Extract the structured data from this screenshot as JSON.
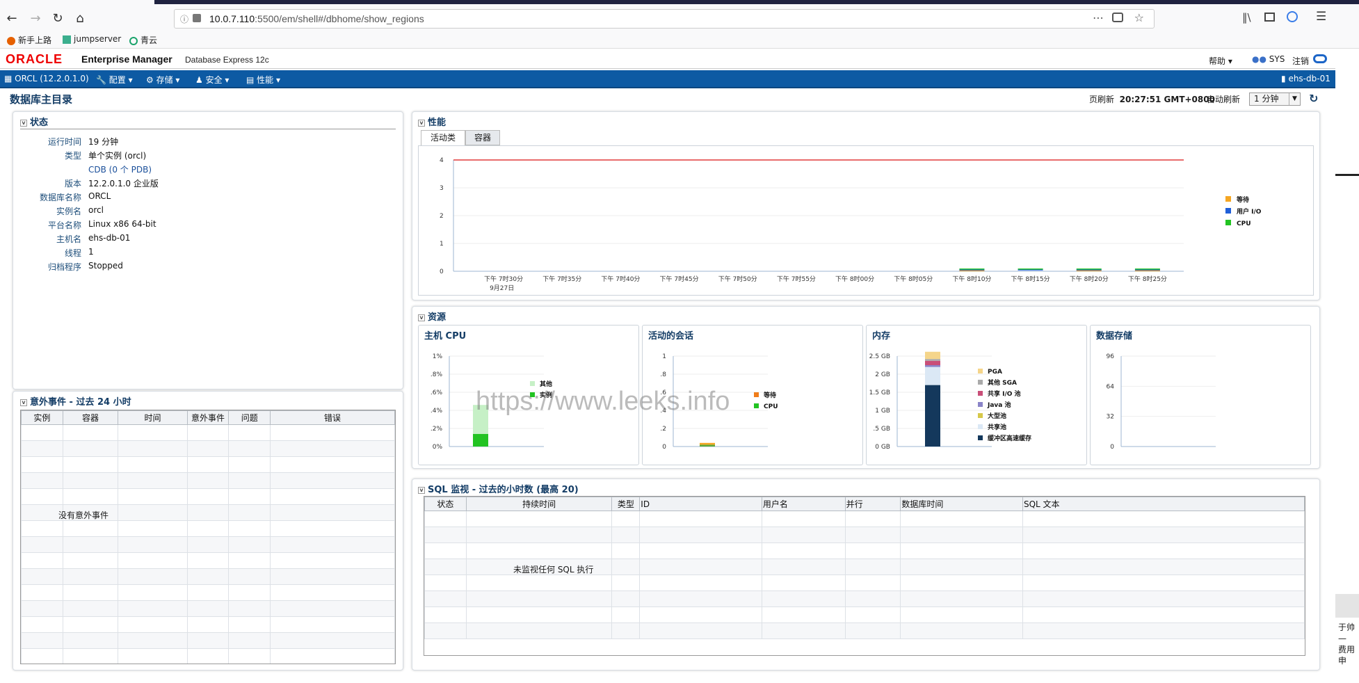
{
  "browser": {
    "url_host": "10.0.7.110",
    "url_rest": ":5500/em/shell#/dbhome/show_regions",
    "bookmarks": [
      "新手上路",
      "jumpserver",
      "青云"
    ]
  },
  "header": {
    "logo": "ORACLE",
    "product": "Enterprise Manager",
    "edition": "Database Express 12c",
    "help": "帮助",
    "user": "SYS",
    "logout": "注销"
  },
  "navbar": {
    "instance": "ORCL (12.2.0.1.0)",
    "menus": [
      "配置",
      "存储",
      "安全",
      "性能"
    ],
    "host": "ehs-db-01"
  },
  "page": {
    "title": "数据库主目录",
    "refresh_label": "页刷新",
    "refresh_time": "20:27:51 GMT+0800",
    "auto_refresh_label": "自动刷新",
    "auto_refresh_value": "1 分钟"
  },
  "status": {
    "title": "状态",
    "rows": [
      {
        "label": "运行时间",
        "value": "19 分钟"
      },
      {
        "label": "类型",
        "value": "单个实例 (orcl)"
      },
      {
        "label": "",
        "value": "CDB (0 个 PDB)"
      },
      {
        "label": "版本",
        "value": "12.2.0.1.0 企业版"
      },
      {
        "label": "数据库名称",
        "value": "ORCL"
      },
      {
        "label": "实例名",
        "value": "orcl"
      },
      {
        "label": "平台名称",
        "value": "Linux x86 64-bit"
      },
      {
        "label": "主机名",
        "value": "ehs-db-01"
      },
      {
        "label": "线程",
        "value": "1"
      },
      {
        "label": "归档程序",
        "value": "Stopped"
      }
    ]
  },
  "incidents": {
    "title": "意外事件 - 过去 24 小时",
    "columns": [
      "实例",
      "容器",
      "时间",
      "意外事件",
      "问题",
      "错误"
    ],
    "empty": "没有意外事件"
  },
  "performance": {
    "title": "性能",
    "tabs": [
      "活动类",
      "容器"
    ],
    "legend": [
      {
        "name": "等待",
        "color": "#f5a623"
      },
      {
        "name": "用户 I/O",
        "color": "#1f5fd8"
      },
      {
        "name": "CPU",
        "color": "#22c322"
      }
    ]
  },
  "resources": {
    "title": "资源",
    "host_cpu": {
      "title": "主机 CPU",
      "legend": [
        "其他",
        "实例"
      ]
    },
    "sessions": {
      "title": "活动的会话",
      "legend": [
        "等待",
        "CPU"
      ]
    },
    "memory": {
      "title": "内存",
      "legend": [
        "PGA",
        "其他 SGA",
        "共享 I/O 池",
        "Java 池",
        "大型池",
        "共享池",
        "缓冲区高速缓存"
      ]
    },
    "storage": {
      "title": "数据存储"
    }
  },
  "sql_monitor": {
    "title": "SQL 监视 - 过去的小时数 (最高 20)",
    "columns": [
      "状态",
      "持续时间",
      "类型",
      "ID",
      "用户名",
      "并行",
      "数据库时间",
      "SQL 文本"
    ],
    "empty": "未监视任何 SQL 执行"
  },
  "watermark": "https://www.leeks.info",
  "side_text": [
    "于帅—",
    "费用申"
  ],
  "chart_data": [
    {
      "type": "line",
      "title": "活动类",
      "x": [
        "下午 7时30分",
        "下午 7时35分",
        "下午 7时40分",
        "下午 7时45分",
        "下午 7时50分",
        "下午 7时55分",
        "下午 8时00分",
        "下午 8时05分",
        "下午 8时10分",
        "下午 8时15分",
        "下午 8时20分",
        "下午 8时25分"
      ],
      "x_sub": "9月27日",
      "ylim": [
        0,
        4
      ],
      "yticks": [
        0,
        1,
        2,
        3,
        4
      ],
      "series": [
        {
          "name": "等待",
          "values": [
            0,
            0,
            0,
            0,
            0,
            0,
            0,
            0,
            0.02,
            0,
            0.02,
            0.04
          ]
        },
        {
          "name": "用户 I/O",
          "values": [
            0,
            0,
            0,
            0,
            0,
            0,
            0,
            0,
            0.04,
            0.01,
            0.01,
            0.01
          ]
        },
        {
          "name": "CPU",
          "values": [
            0,
            0,
            0,
            0,
            0,
            0,
            0,
            0,
            0.02,
            0.01,
            0.01,
            0.01
          ]
        }
      ],
      "reference_line": 4
    },
    {
      "type": "bar",
      "title": "主机 CPU",
      "yticks": [
        "0%",
        ".2%",
        ".4%",
        ".6%",
        ".8%",
        "1%"
      ],
      "ylim": [
        0,
        1
      ],
      "series": [
        {
          "name": "实例",
          "values": [
            0.14
          ]
        },
        {
          "name": "其他",
          "values": [
            0.32
          ]
        }
      ]
    },
    {
      "type": "bar",
      "title": "活动的会话",
      "yticks": [
        "0",
        ".2",
        ".4",
        ".6",
        ".8",
        "1"
      ],
      "ylim": [
        0,
        1
      ],
      "series": [
        {
          "name": "CPU",
          "values": [
            0.02
          ]
        },
        {
          "name": "等待",
          "values": [
            0.02
          ]
        }
      ]
    },
    {
      "type": "bar",
      "title": "内存",
      "yticks": [
        "0 GB",
        ".5 GB",
        "1 GB",
        "1.5 GB",
        "2 GB",
        "2.5 GB"
      ],
      "ylim": [
        0,
        2.5
      ],
      "series": [
        {
          "name": "缓冲区高速缓存",
          "values": [
            1.7
          ]
        },
        {
          "name": "共享池",
          "values": [
            0.5
          ]
        },
        {
          "name": "Java 池",
          "values": [
            0.05
          ]
        },
        {
          "name": "共享 I/O 池",
          "values": [
            0.12
          ]
        },
        {
          "name": "其他 SGA",
          "values": [
            0.05
          ]
        },
        {
          "name": "PGA",
          "values": [
            0.2
          ]
        }
      ]
    },
    {
      "type": "bar",
      "title": "数据存储",
      "yticks": [
        "0",
        "32",
        "64",
        "96"
      ],
      "ylim": [
        0,
        96
      ]
    }
  ]
}
